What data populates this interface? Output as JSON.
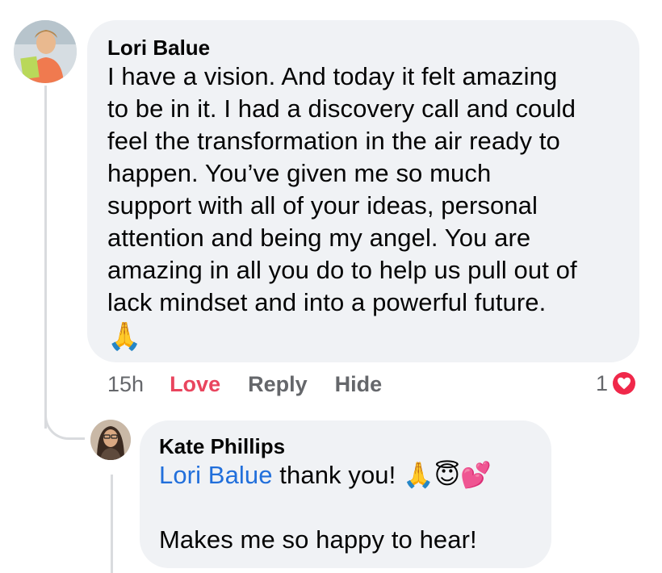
{
  "comment": {
    "author": "Lori Balue",
    "lines": [
      "I have a vision. And today it felt amazing",
      "to be in it. I had a discovery call and could",
      "feel the transformation in the air ready to",
      "happen. You’ve given me so much",
      "support with all of your ideas, personal",
      "attention and being my angel. You are",
      "amazing in all you do to help us pull out of",
      "lack mindset and into a powerful future."
    ],
    "emoji": "🙏",
    "time": "15h",
    "love_label": "Love",
    "reply_label": "Reply",
    "hide_label": "Hide",
    "reaction_count": "1",
    "reaction_icon": "heart-icon",
    "reaction_color": "#f0284a"
  },
  "reply": {
    "author": "Kate Phillips",
    "mention": "Lori Balue",
    "text": " thank you! ",
    "emojis": "🙏😇💕",
    "second_line": "Makes me so happy to hear!"
  },
  "colors": {
    "bubble": "#f0f2f5",
    "mention": "#216fdb",
    "love": "#e9455e",
    "meta": "#65676b"
  }
}
